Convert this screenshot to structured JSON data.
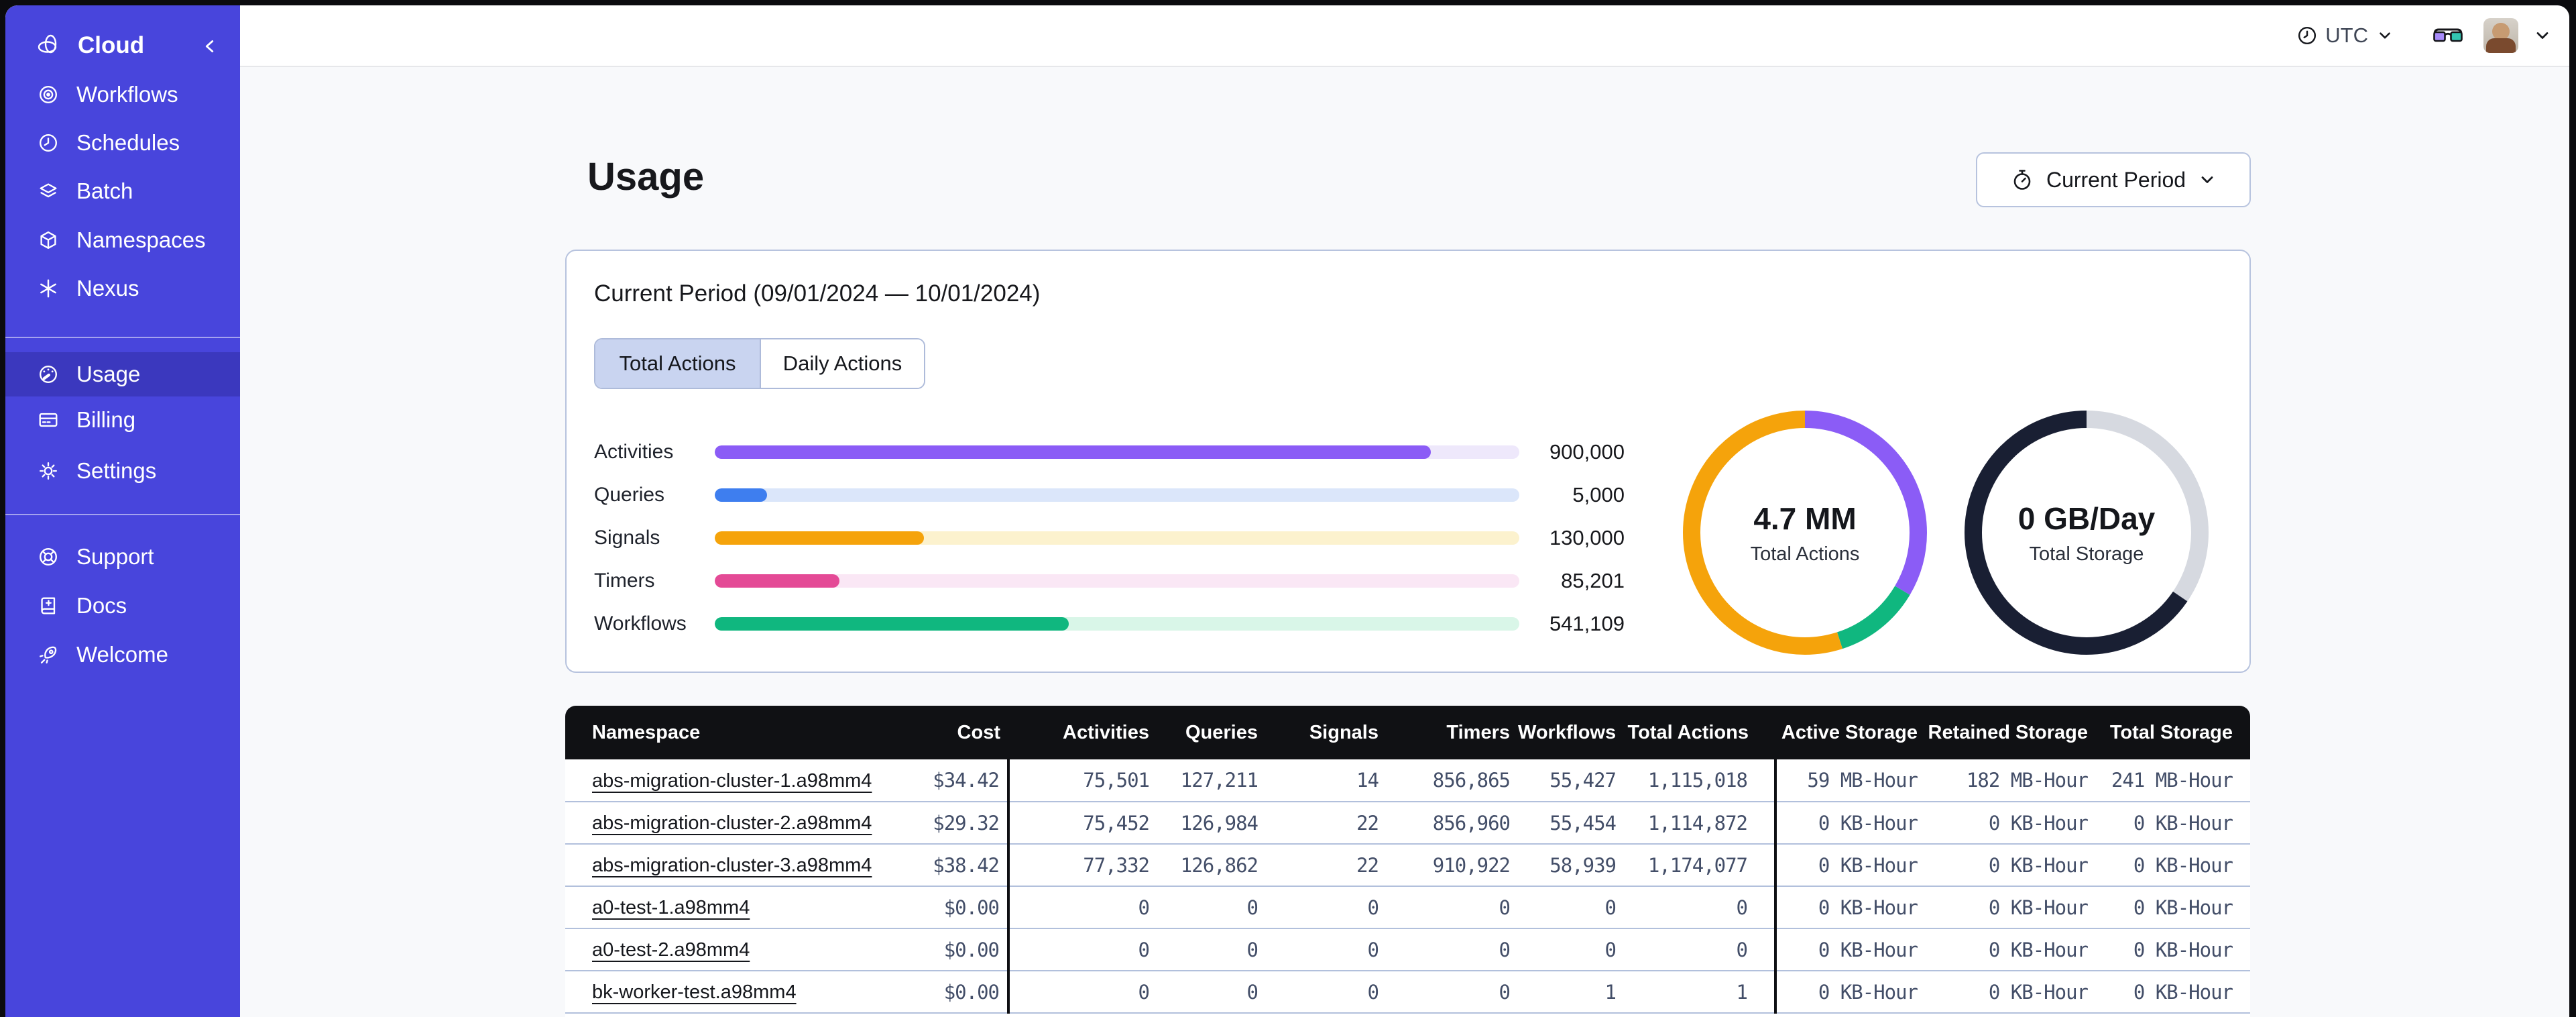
{
  "colors": {
    "backdrop": "#0B0B0E",
    "sidebar_bg": "#4845DC",
    "sidebar_active_bg": "#3B38BE",
    "page_bg": "#F8F9FB",
    "card_border": "#B7C3DE",
    "tab_active_bg": "#C9D4F0",
    "table_header_bg": "#101114",
    "row_divider": "#B2C0DC",
    "cell_text": "#434E68",
    "link_text": "#15171C"
  },
  "sidebar": {
    "brand": {
      "label": "Cloud"
    },
    "nav_main": [
      {
        "label": "Workflows"
      },
      {
        "label": "Schedules"
      },
      {
        "label": "Batch"
      },
      {
        "label": "Namespaces"
      },
      {
        "label": "Nexus"
      }
    ],
    "nav_account": [
      {
        "label": "Usage",
        "active": true
      },
      {
        "label": "Billing",
        "active": false
      },
      {
        "label": "Settings",
        "active": false
      }
    ],
    "nav_footer": [
      {
        "label": "Support"
      },
      {
        "label": "Docs"
      },
      {
        "label": "Welcome"
      }
    ]
  },
  "topbar": {
    "timezone": "UTC"
  },
  "page": {
    "title": "Usage",
    "period_button_label": "Current Period"
  },
  "usage_card": {
    "title": "Current Period (09/01/2024 — 10/01/2024)",
    "tabs": [
      {
        "label": "Total Actions",
        "active": true
      },
      {
        "label": "Daily Actions",
        "active": false
      }
    ]
  },
  "chart_data": [
    {
      "type": "bar",
      "orientation": "horizontal",
      "title": "Actions by type (Current Period)",
      "categories": [
        "Activities",
        "Queries",
        "Signals",
        "Timers",
        "Workflows"
      ],
      "values": [
        900000,
        5000,
        130000,
        85201,
        541109
      ],
      "value_labels": [
        "900,000",
        "5,000",
        "130,000",
        "85,201",
        "541,109"
      ],
      "fill_pct": [
        89,
        6.5,
        26,
        15.5,
        44
      ],
      "bar_colors": [
        "#8B5CF6",
        "#3E7EEF",
        "#F5A30B",
        "#E44A96",
        "#10B77F"
      ],
      "track_colors": [
        "#EEE8FB",
        "#DBE6FA",
        "#FCF2CE",
        "#FAE7F5",
        "#D9F6E8"
      ]
    },
    {
      "type": "donut",
      "center_value": "4.7 MM",
      "center_label": "Total Actions",
      "segments": [
        {
          "color": "#8B5CF6",
          "pct": 33.5
        },
        {
          "color": "#10B77F",
          "pct": 11.5
        },
        {
          "color": "#F5A30B",
          "pct": 55
        }
      ]
    },
    {
      "type": "donut",
      "center_value": "0 GB/Day",
      "center_label": "Total Storage",
      "segments": [
        {
          "color": "#D6D9E0",
          "pct": 34.5
        },
        {
          "color": "#191F33",
          "pct": 65.5
        }
      ]
    }
  ],
  "table": {
    "columns": [
      "Namespace",
      "Cost",
      "Activities",
      "Queries",
      "Signals",
      "Timers",
      "Workflows",
      "Total Actions",
      "Active Storage",
      "Retained Storage",
      "Total Storage"
    ],
    "rows": [
      [
        "abs-migration-cluster-1.a98mm4",
        "$34.42",
        "75,501",
        "127,211",
        "14",
        "856,865",
        "55,427",
        "1,115,018",
        "59 MB-Hour",
        "182 MB-Hour",
        "241 MB-Hour"
      ],
      [
        "abs-migration-cluster-2.a98mm4",
        "$29.32",
        "75,452",
        "126,984",
        "22",
        "856,960",
        "55,454",
        "1,114,872",
        "0 KB-Hour",
        "0 KB-Hour",
        "0 KB-Hour"
      ],
      [
        "abs-migration-cluster-3.a98mm4",
        "$38.42",
        "77,332",
        "126,862",
        "22",
        "910,922",
        "58,939",
        "1,174,077",
        "0 KB-Hour",
        "0 KB-Hour",
        "0 KB-Hour"
      ],
      [
        "a0-test-1.a98mm4",
        "$0.00",
        "0",
        "0",
        "0",
        "0",
        "0",
        "0",
        "0 KB-Hour",
        "0 KB-Hour",
        "0 KB-Hour"
      ],
      [
        "a0-test-2.a98mm4",
        "$0.00",
        "0",
        "0",
        "0",
        "0",
        "0",
        "0",
        "0 KB-Hour",
        "0 KB-Hour",
        "0 KB-Hour"
      ],
      [
        "bk-worker-test.a98mm4",
        "$0.00",
        "0",
        "0",
        "0",
        "0",
        "1",
        "1",
        "0 KB-Hour",
        "0 KB-Hour",
        "0 KB-Hour"
      ]
    ]
  }
}
